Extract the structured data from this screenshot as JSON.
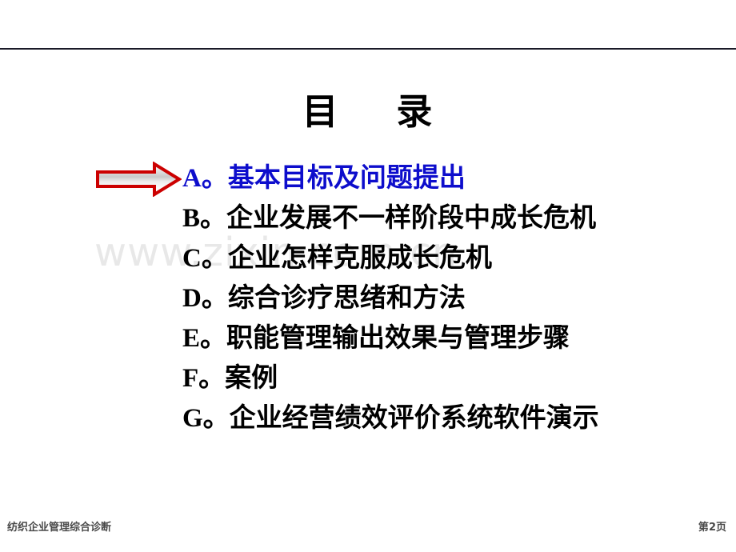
{
  "slide": {
    "title": "目    录",
    "page_background": "#ffffff",
    "rule_color": "#1a1a28",
    "highlight_color": "#0d0dcc",
    "arrow_outline_color": "#cc0000",
    "arrow_fill_color": "#f2f2f2"
  },
  "watermark": {
    "text": "www.zixin.com.cn",
    "color": "#e8e8e8"
  },
  "toc": {
    "items": [
      {
        "letter": "A。",
        "text": "基本目标及问题提出",
        "highlighted": true
      },
      {
        "letter": "B。",
        "text": "企业发展不一样阶段中成长危机",
        "highlighted": false
      },
      {
        "letter": "C。",
        "text": "企业怎样克服成长危机",
        "highlighted": false
      },
      {
        "letter": "D。",
        "text": "综合诊疗思绪和方法",
        "highlighted": false
      },
      {
        "letter": "E。",
        "text": "职能管理输出效果与管理步骤",
        "highlighted": false
      },
      {
        "letter": "F。",
        "text": "案例",
        "highlighted": false
      },
      {
        "letter": "G。",
        "text": "企业经营绩效评价系统软件演示",
        "highlighted": false
      }
    ]
  },
  "marker": {
    "icon": "right-arrow-icon"
  },
  "footer": {
    "left_text": "纺织企业管理综合诊断",
    "page_prefix": "第",
    "page_number": "2",
    "page_suffix": "页"
  }
}
